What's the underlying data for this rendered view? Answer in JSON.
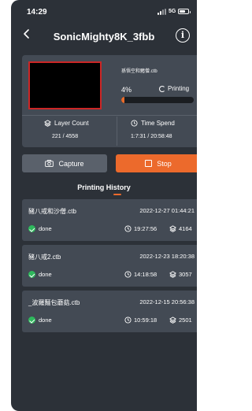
{
  "status_bar": {
    "time": "14:29",
    "network": "5G"
  },
  "header": {
    "title": "SonicMighty8K_3fbb",
    "info_label": "i"
  },
  "current_job": {
    "filename": "孫悟空和豬僧.ctb",
    "percent_text": "4%",
    "progress_fraction": 0.04,
    "state": "Printing",
    "layer_count_label": "Layer Count",
    "layer_count_value": "221 / 4558",
    "time_spend_label": "Time Spend",
    "time_spend_value": "1:7:31 / 20:58:48"
  },
  "actions": {
    "capture_label": "Capture",
    "stop_label": "Stop"
  },
  "history": {
    "title": "Printing History",
    "items": [
      {
        "name": "豬八戒和沙僧.ctb",
        "date": "2022-12-27 01:44:21",
        "status": "done",
        "duration": "19:27:56",
        "layers": "4164"
      },
      {
        "name": "豬八戒2.ctb",
        "date": "2022-12-23 18:20:38",
        "status": "done",
        "duration": "14:18:58",
        "layers": "3057"
      },
      {
        "name": "_波羅麵包蘑菇.ctb",
        "date": "2022-12-15 20:56:38",
        "status": "done",
        "duration": "10:59:18",
        "layers": "2501"
      }
    ]
  },
  "colors": {
    "accent": "#ec6a2c",
    "background": "#2c3138",
    "card": "#434a54",
    "success": "#2eb85c",
    "thumb_border": "#cc2626"
  }
}
